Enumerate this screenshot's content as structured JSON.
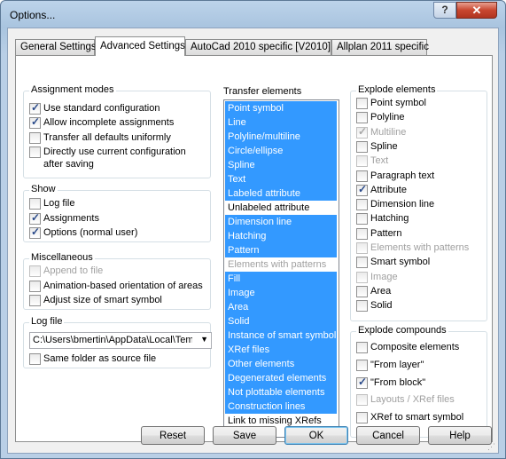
{
  "window": {
    "title": "Options..."
  },
  "tabs": [
    {
      "label": "General Settings"
    },
    {
      "label": "Advanced Settings"
    },
    {
      "label": "AutoCad 2010 specific [V2010]"
    },
    {
      "label": "Allplan 2011 specific"
    }
  ],
  "assignment_modes": {
    "title": "Assignment modes",
    "items": [
      {
        "label": "Use standard configuration",
        "checked": true
      },
      {
        "label": "Allow incomplete assignments",
        "checked": true
      },
      {
        "label": "Transfer all defaults uniformly",
        "checked": false
      },
      {
        "label": "Directly use current configuration",
        "label2": "after saving",
        "checked": false
      }
    ]
  },
  "show": {
    "title": "Show",
    "items": [
      {
        "label": "Log file",
        "checked": false
      },
      {
        "label": "Assignments",
        "checked": true
      },
      {
        "label": "Options (normal user)",
        "checked": true
      }
    ]
  },
  "miscellaneous": {
    "title": "Miscellaneous",
    "items": [
      {
        "label": "Append to file",
        "checked": false,
        "disabled": true
      },
      {
        "label": "Animation-based orientation of areas",
        "checked": false
      },
      {
        "label": "Adjust size of smart symbol",
        "checked": false
      }
    ]
  },
  "log_file": {
    "title": "Log file",
    "path": "C:\\Users\\bmertin\\AppData\\Local\\Tem",
    "same_folder": {
      "label": "Same folder as source file",
      "checked": false
    }
  },
  "transfer_elements": {
    "title": "Transfer elements",
    "items": [
      {
        "label": "Point symbol",
        "selected": true
      },
      {
        "label": "Line",
        "selected": true
      },
      {
        "label": "Polyline/multiline",
        "selected": true
      },
      {
        "label": "Circle/ellipse",
        "selected": true
      },
      {
        "label": "Spline",
        "selected": true
      },
      {
        "label": "Text",
        "selected": true
      },
      {
        "label": "Labeled attribute",
        "selected": true
      },
      {
        "label": "Unlabeled attribute",
        "selected": false
      },
      {
        "label": "Dimension line",
        "selected": true
      },
      {
        "label": "Hatching",
        "selected": true
      },
      {
        "label": "Pattern",
        "selected": true
      },
      {
        "label": "Elements with patterns",
        "selected": false,
        "disabled": true
      },
      {
        "label": "Fill",
        "selected": true
      },
      {
        "label": "Image",
        "selected": true
      },
      {
        "label": "Area",
        "selected": true
      },
      {
        "label": "Solid",
        "selected": true
      },
      {
        "label": "Instance of smart symbol",
        "selected": true
      },
      {
        "label": "XRef files",
        "selected": true
      },
      {
        "label": "Other elements",
        "selected": true
      },
      {
        "label": "Degenerated elements",
        "selected": true
      },
      {
        "label": "Not plottable elements",
        "selected": true
      },
      {
        "label": "Construction lines",
        "selected": true
      },
      {
        "label": "Link to missing XRefs",
        "selected": false
      }
    ]
  },
  "explode_elements": {
    "title": "Explode elements",
    "items": [
      {
        "label": "Point symbol",
        "checked": false
      },
      {
        "label": "Polyline",
        "checked": false
      },
      {
        "label": "Multiline",
        "checked": true,
        "disabled": true
      },
      {
        "label": "Spline",
        "checked": false
      },
      {
        "label": "Text",
        "checked": false,
        "disabled": true
      },
      {
        "label": "Paragraph text",
        "checked": false
      },
      {
        "label": "Attribute",
        "checked": true
      },
      {
        "label": "Dimension line",
        "checked": false
      },
      {
        "label": "Hatching",
        "checked": false
      },
      {
        "label": "Pattern",
        "checked": false
      },
      {
        "label": "Elements with patterns",
        "checked": false,
        "disabled": true
      },
      {
        "label": "Smart symbol",
        "checked": false
      },
      {
        "label": "Image",
        "checked": false,
        "disabled": true
      },
      {
        "label": "Area",
        "checked": false
      },
      {
        "label": "Solid",
        "checked": false
      }
    ]
  },
  "explode_compounds": {
    "title": "Explode compounds",
    "items": [
      {
        "label": "Composite elements",
        "checked": false
      },
      {
        "label": "\"From layer\"",
        "checked": false
      },
      {
        "label": "\"From block\"",
        "checked": true
      },
      {
        "label": "Layouts / XRef files",
        "checked": false,
        "disabled": true
      },
      {
        "label": "XRef to smart symbol",
        "checked": false
      }
    ]
  },
  "buttons": {
    "reset": "Reset",
    "save": "Save",
    "ok": "OK",
    "cancel": "Cancel",
    "help": "Help"
  },
  "icons": {
    "help": "?",
    "close": "✕",
    "combo_arrow": "▼"
  }
}
